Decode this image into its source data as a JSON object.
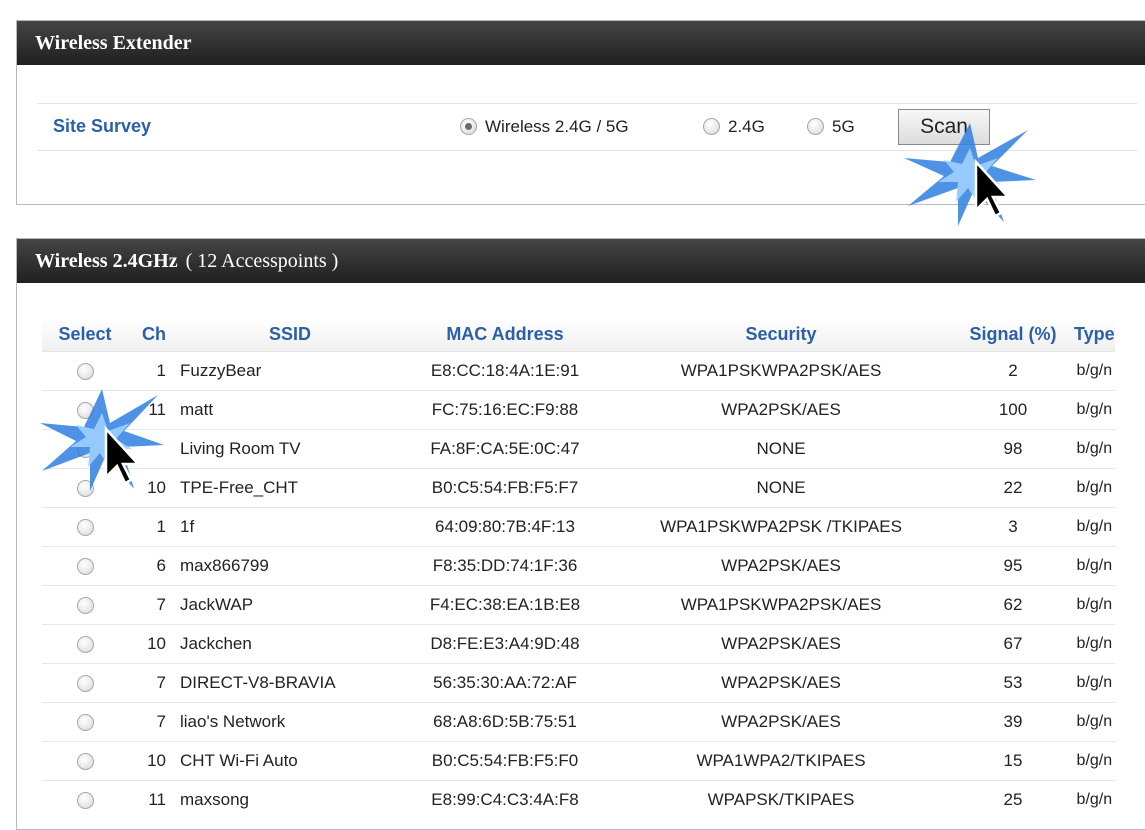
{
  "extender": {
    "title": "Wireless Extender",
    "site_survey_label": "Site Survey",
    "band_options": [
      {
        "label": "Wireless 2.4G / 5G",
        "checked": true
      },
      {
        "label": "2.4G",
        "checked": false
      },
      {
        "label": "5G",
        "checked": false
      }
    ],
    "scan_label": "Scan"
  },
  "ap_list": {
    "title": "Wireless 2.4GHz",
    "count_text": "( 12 Accesspoints )",
    "columns": [
      "Select",
      "Ch",
      "SSID",
      "MAC Address",
      "Security",
      "Signal (%)",
      "Type"
    ],
    "rows": [
      {
        "ch": "1",
        "ssid": "FuzzyBear",
        "mac": "E8:CC:18:4A:1E:91",
        "security": "WPA1PSKWPA2PSK/AES",
        "signal": "2",
        "type": "b/g/n"
      },
      {
        "ch": "11",
        "ssid": "matt",
        "mac": "FC:75:16:EC:F9:88",
        "security": "WPA2PSK/AES",
        "signal": "100",
        "type": "b/g/n"
      },
      {
        "ch": "",
        "ssid": "Living Room TV",
        "mac": "FA:8F:CA:5E:0C:47",
        "security": "NONE",
        "signal": "98",
        "type": "b/g/n"
      },
      {
        "ch": "10",
        "ssid": "TPE-Free_CHT",
        "mac": "B0:C5:54:FB:F5:F7",
        "security": "NONE",
        "signal": "22",
        "type": "b/g/n"
      },
      {
        "ch": "1",
        "ssid": "1f",
        "mac": "64:09:80:7B:4F:13",
        "security": "WPA1PSKWPA2PSK /TKIPAES",
        "signal": "3",
        "type": "b/g/n"
      },
      {
        "ch": "6",
        "ssid": "max866799",
        "mac": "F8:35:DD:74:1F:36",
        "security": "WPA2PSK/AES",
        "signal": "95",
        "type": "b/g/n"
      },
      {
        "ch": "7",
        "ssid": "JackWAP",
        "mac": "F4:EC:38:EA:1B:E8",
        "security": "WPA1PSKWPA2PSK/AES",
        "signal": "62",
        "type": "b/g/n"
      },
      {
        "ch": "10",
        "ssid": "Jackchen",
        "mac": "D8:FE:E3:A4:9D:48",
        "security": "WPA2PSK/AES",
        "signal": "67",
        "type": "b/g/n"
      },
      {
        "ch": "7",
        "ssid": "DIRECT-V8-BRAVIA",
        "mac": "56:35:30:AA:72:AF",
        "security": "WPA2PSK/AES",
        "signal": "53",
        "type": "b/g/n"
      },
      {
        "ch": "7",
        "ssid": "liao's Network",
        "mac": "68:A8:6D:5B:75:51",
        "security": "WPA2PSK/AES",
        "signal": "39",
        "type": "b/g/n"
      },
      {
        "ch": "10",
        "ssid": "CHT Wi-Fi Auto",
        "mac": "B0:C5:54:FB:F5:F0",
        "security": "WPA1WPA2/TKIPAES",
        "signal": "15",
        "type": "b/g/n"
      },
      {
        "ch": "11",
        "ssid": "maxsong",
        "mac": "E8:99:C4:C3:4A:F8",
        "security": "WPAPSK/TKIPAES",
        "signal": "25",
        "type": "b/g/n"
      }
    ]
  },
  "colors": {
    "header_bg": "#2a2a2a",
    "label_blue": "#2b5fa8",
    "burst_blue": "#2f7fe0"
  },
  "annotations": [
    {
      "icon": "click-burst-icon",
      "target": "scan-button"
    },
    {
      "icon": "click-burst-icon",
      "target": "ap-select-radio"
    }
  ]
}
